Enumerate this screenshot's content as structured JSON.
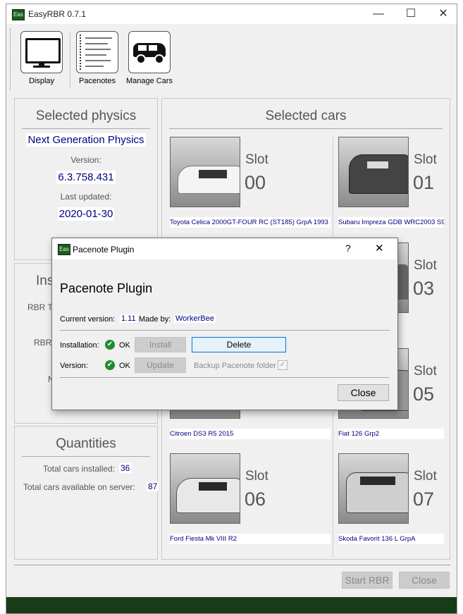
{
  "window": {
    "title": "EasyRBR 0.7.1",
    "icon_text": "Eas"
  },
  "toolbar": {
    "items": [
      {
        "label": "Display"
      },
      {
        "label": "Pacenotes"
      },
      {
        "label": "Manage Cars"
      }
    ]
  },
  "physics": {
    "title": "Selected physics",
    "name": "Next Generation Physics",
    "version_label": "Version:",
    "version": "6.3.758.431",
    "updated_label": "Last updated:",
    "updated": "2020-01-30"
  },
  "install_panel": {
    "title_partial": "Ins",
    "rows": [
      "RBR T",
      "RBR i",
      "N"
    ]
  },
  "quantities": {
    "title": "Quantities",
    "installed_label": "Total cars installed:",
    "installed": "36",
    "server_label": "Total cars available on server:",
    "server": "87"
  },
  "cars": {
    "title": "Selected cars",
    "slot_label": "Slot",
    "slots": [
      {
        "num": "00",
        "name": "Toyota Celica 2000GT-FOUR RC (ST185) GrpA 1993"
      },
      {
        "num": "01",
        "name": "Subaru Impreza GDB WRC2003 S9"
      },
      {
        "num": "03",
        "name": ""
      },
      {
        "num": "05",
        "name": "Fiat 126 Grp2"
      },
      {
        "num": "06",
        "name": "Ford Fiesta Mk VIII R2"
      },
      {
        "num": "07",
        "name": "Skoda Favorit 136 L GrpA"
      }
    ],
    "partial_name": "Citroen DS3 R5 2015"
  },
  "footer": {
    "start_label": "Start RBR",
    "close_label": "Close"
  },
  "dialog": {
    "title": "Pacenote Plugin",
    "icon_text": "Eas",
    "help": "?",
    "close_x": "✕",
    "heading": "Pacenote Plugin",
    "current_version_label": "Current version:",
    "current_version": "1.11",
    "made_by_label": "Made by:",
    "made_by": "WorkerBee",
    "installation_label": "Installation:",
    "installation_status": "OK",
    "install_button": "Install",
    "delete_button": "Delete",
    "version_label": "Version:",
    "version_status": "OK",
    "update_button": "Update",
    "backup_label": "Backup Pacenote folder",
    "close_button": "Close"
  },
  "colors": {
    "accent": "#000080",
    "status_ok": "#1a8f2e",
    "footer_bar": "#173c17"
  }
}
